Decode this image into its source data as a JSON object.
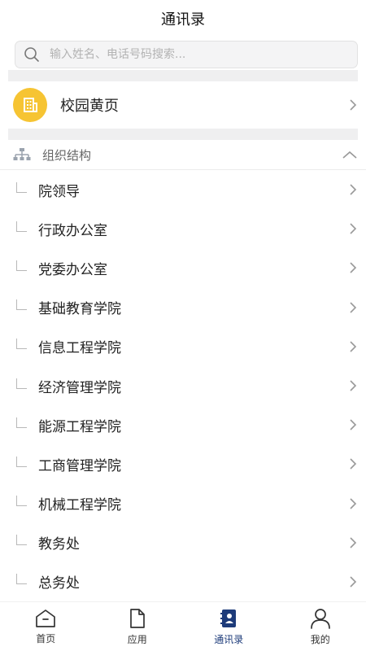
{
  "header": {
    "title": "通讯录"
  },
  "search": {
    "placeholder": "输入姓名、电话号码搜索..."
  },
  "yellow_pages": {
    "label": "校园黄页"
  },
  "org": {
    "title": "组织结构",
    "items": [
      {
        "label": "院领导"
      },
      {
        "label": "行政办公室"
      },
      {
        "label": "党委办公室"
      },
      {
        "label": "基础教育学院"
      },
      {
        "label": "信息工程学院"
      },
      {
        "label": "经济管理学院"
      },
      {
        "label": "能源工程学院"
      },
      {
        "label": "工商管理学院"
      },
      {
        "label": "机械工程学院"
      },
      {
        "label": "教务处"
      },
      {
        "label": "总务处"
      }
    ]
  },
  "tabbar": {
    "tabs": [
      {
        "label": "首页"
      },
      {
        "label": "应用"
      },
      {
        "label": "通讯录"
      },
      {
        "label": "我的"
      }
    ],
    "active_color": "#1d3b7a"
  },
  "colors": {
    "accent": "#f6c433",
    "background": "#ffffff"
  }
}
